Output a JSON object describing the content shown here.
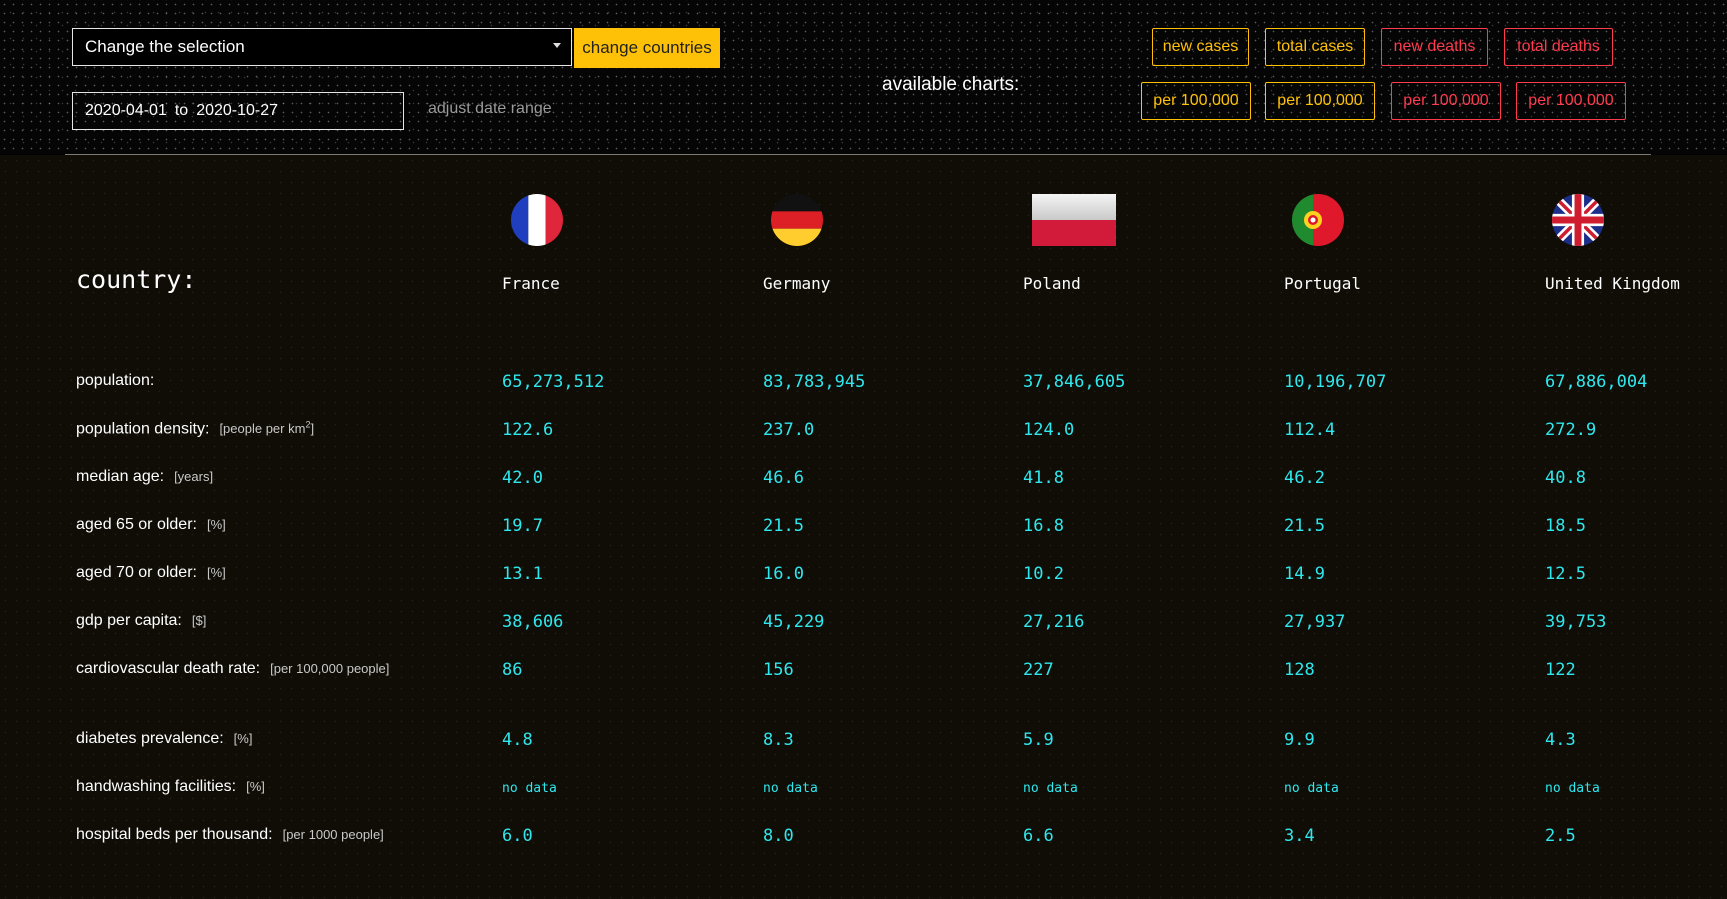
{
  "header": {
    "select_placeholder": "Change the selection",
    "change_button": "change countries",
    "date_from": "2020-04-01",
    "date_to_word": "to",
    "date_to": "2020-10-27",
    "adjust_label": "adjust date range",
    "available_charts_label": "available charts:",
    "chart_buttons_row1": [
      "new cases",
      "total cases",
      "new deaths",
      "total deaths"
    ],
    "chart_buttons_row2": [
      "per 100,000",
      "per 100,000",
      "per 100,000",
      "per 100,000"
    ],
    "colors": {
      "cases": "#ffc107",
      "deaths": "#ff3b4e",
      "values": "#2fe7ee"
    }
  },
  "table": {
    "country_label": "country:",
    "countries": [
      "France",
      "Germany",
      "Poland",
      "Portugal",
      "United Kingdom"
    ],
    "flag_icons": [
      "france-flag-icon",
      "germany-flag-icon",
      "poland-flag-icon",
      "portugal-flag-icon",
      "uk-flag-icon"
    ],
    "rows": [
      {
        "label": "population:",
        "unit": "",
        "values": [
          "65,273,512",
          "83,783,945",
          "37,846,605",
          "10,196,707",
          "67,886,004"
        ]
      },
      {
        "label": "population density:",
        "unit": "[people per km",
        "unit_sup": "2",
        "unit_end": "]",
        "values": [
          "122.6",
          "237.0",
          "124.0",
          "112.4",
          "272.9"
        ]
      },
      {
        "label": "median age:",
        "unit": "[years]",
        "values": [
          "42.0",
          "46.6",
          "41.8",
          "46.2",
          "40.8"
        ]
      },
      {
        "label": "aged 65 or older:",
        "unit": "[%]",
        "values": [
          "19.7",
          "21.5",
          "16.8",
          "21.5",
          "18.5"
        ]
      },
      {
        "label": "aged 70 or older:",
        "unit": "[%]",
        "values": [
          "13.1",
          "16.0",
          "10.2",
          "14.9",
          "12.5"
        ]
      },
      {
        "label": "gdp per capita:",
        "unit": "[$]",
        "values": [
          "38,606",
          "45,229",
          "27,216",
          "27,937",
          "39,753"
        ]
      },
      {
        "label": "cardiovascular death rate:",
        "unit": "[per 100,000 people]",
        "values": [
          "86",
          "156",
          "227",
          "128",
          "122"
        ]
      },
      {
        "label": "diabetes prevalence:",
        "unit": "[%]",
        "values": [
          "4.8",
          "8.3",
          "5.9",
          "9.9",
          "4.3"
        ]
      },
      {
        "label": "handwashing facilities:",
        "unit": "[%]",
        "values": [
          "no data",
          "no data",
          "no data",
          "no data",
          "no data"
        ]
      },
      {
        "label": "hospital beds per thousand:",
        "unit": "[per 1000 people]",
        "values": [
          "6.0",
          "8.0",
          "6.6",
          "3.4",
          "2.5"
        ]
      }
    ]
  }
}
